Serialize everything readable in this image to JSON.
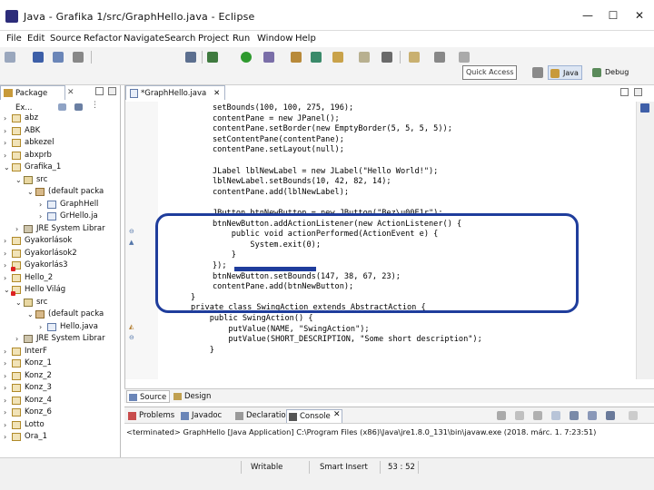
{
  "window": {
    "title": "Java - Grafika 1/src/GraphHello.java - Eclipse",
    "minimize": "—",
    "maximize": "☐",
    "close": "✕"
  },
  "menu": [
    "File",
    "Edit",
    "Source",
    "Refactor",
    "Navigate",
    "Search",
    "Project",
    "Run",
    "Window",
    "Help"
  ],
  "toolbar": {
    "quick_access": "Quick Access",
    "perspectives": [
      "Java",
      "Debug"
    ]
  },
  "package_explorer": {
    "tab_label": "Package Ex...",
    "items": [
      {
        "label": "abz",
        "type": "proj",
        "arrow": "›"
      },
      {
        "label": "ABK",
        "type": "proj",
        "arrow": "›"
      },
      {
        "label": "abkezel",
        "type": "proj",
        "arrow": "›"
      },
      {
        "label": "abxprb",
        "type": "proj",
        "arrow": "›"
      },
      {
        "label": "Grafika_1",
        "type": "proj",
        "arrow": "⌄"
      },
      {
        "label": "src",
        "type": "src",
        "arrow": "⌄"
      },
      {
        "label": "(default packa",
        "type": "pack",
        "arrow": "⌄"
      },
      {
        "label": "GraphHell",
        "type": "java",
        "arrow": "›"
      },
      {
        "label": "GrHello.ja",
        "type": "java",
        "arrow": "›"
      },
      {
        "label": "JRE System Librar",
        "type": "lib",
        "arrow": "›"
      },
      {
        "label": "Gyakorlások",
        "type": "proj",
        "arrow": "›"
      },
      {
        "label": "Gyakorlások2",
        "type": "proj",
        "arrow": "›"
      },
      {
        "label": "Gyakorlás3",
        "type": "err",
        "arrow": "›"
      },
      {
        "label": "Hello_2",
        "type": "proj",
        "arrow": "›"
      },
      {
        "label": "Hello Világ",
        "type": "err",
        "arrow": "⌄"
      },
      {
        "label": "src",
        "type": "src",
        "arrow": "⌄"
      },
      {
        "label": "(default packa",
        "type": "pack",
        "arrow": "⌄"
      },
      {
        "label": "Hello.java",
        "type": "java",
        "arrow": "›"
      },
      {
        "label": "JRE System Librar",
        "type": "lib",
        "arrow": "›"
      },
      {
        "label": "InterF",
        "type": "proj",
        "arrow": "›"
      },
      {
        "label": "Konz_1",
        "type": "proj",
        "arrow": "›"
      },
      {
        "label": "Konz_2",
        "type": "proj",
        "arrow": "›"
      },
      {
        "label": "Konz_3",
        "type": "proj",
        "arrow": "›"
      },
      {
        "label": "Konz_4",
        "type": "proj",
        "arrow": "›"
      },
      {
        "label": "Konz_6",
        "type": "proj",
        "arrow": "›"
      },
      {
        "label": "Lotto",
        "type": "proj",
        "arrow": "›"
      },
      {
        "label": "Ora_1",
        "type": "proj",
        "arrow": "›"
      }
    ]
  },
  "editor": {
    "tab_label": "*GraphHello.java",
    "lines": [
      "setBounds(100, 100, 275, 196);",
      "contentPane = new JPanel();",
      "contentPane.setBorder(new EmptyBorder(5, 5, 5, 5));",
      "setContentPane(contentPane);",
      "contentPane.setLayout(null);",
      "",
      "JLabel lblNewLabel = new JLabel(\"Hello World!\");",
      "lblNewLabel.setBounds(10, 42, 82, 14);",
      "contentPane.add(lblNewLabel);",
      "",
      "JButton btnNewButton = new JButton(\"Bez\\u00E1r\");",
      "btnNewButton.addActionListener(new ActionListener() {",
      "    public void actionPerformed(ActionEvent e) {",
      "        System.exit(0);",
      "    }",
      "});",
      "btnNewButton.setBounds(147, 38, 67, 23);",
      "contentPane.add(btnNewButton);",
      "}",
      "private class SwingAction extends AbstractAction {",
      "    public SwingAction() {",
      "        putValue(NAME, \"SwingAction\");",
      "        putValue(SHORT_DESCRIPTION, \"Some short description\");",
      "    }"
    ],
    "bottom_tabs": [
      "Source",
      "Design"
    ]
  },
  "bottom_panel": {
    "tabs": [
      "Problems",
      "Javadoc",
      "Declaration",
      "Console"
    ],
    "console_text": "<terminated> GraphHello [Java Application] C:\\Program Files (x86)\\Java\\jre1.8.0_131\\bin\\javaw.exe (2018. márc. 1. 7:23:51)"
  },
  "status": {
    "writable": "Writable",
    "insert_mode": "Smart Insert",
    "position": "53 : 52"
  },
  "colors": {
    "annotation": "#1f3d9c",
    "keyword": "#7f0055",
    "string": "#2a00ff"
  }
}
